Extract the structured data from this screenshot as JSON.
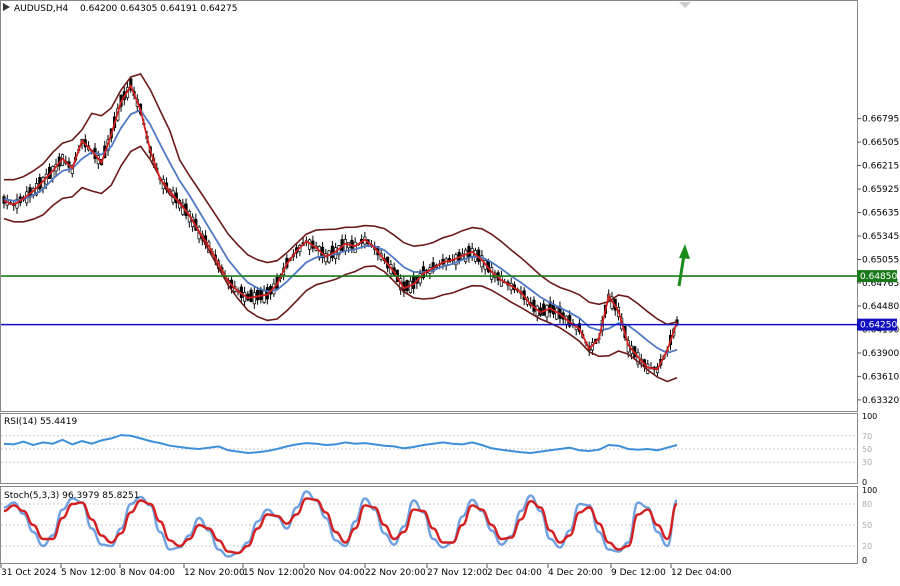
{
  "header": {
    "symbol": "AUDUSD,H4",
    "ohlc": "0.64200 0.64305 0.64191 0.64275"
  },
  "colors": {
    "price": "#000000",
    "bollinger": "#6b1a1a",
    "ma_fast": "#d42020",
    "ma_slow": "#4a7fd0",
    "support_line": "#1010c0",
    "resistance_line": "#1a7a1a",
    "arrow": "#1a8a1a",
    "rsi": "#3d8fd8",
    "stoch_main": "#6fa0e0",
    "stoch_signal": "#d42020"
  },
  "chart_data": [
    {
      "type": "line",
      "title": "AUDUSD,H4",
      "subtitle": "0.64200 0.64305 0.64191 0.64275",
      "ylim": [
        0.6322,
        0.681
      ],
      "y_ticks": [
        "0.66795",
        "0.66505",
        "0.66215",
        "0.65925",
        "0.65635",
        "0.65345",
        "0.65055",
        "0.64765",
        "0.64480",
        "0.64190",
        "0.63900",
        "0.63610",
        "0.63320"
      ],
      "x_ticks": [
        "31 Oct 2024",
        "5 Nov 12:00",
        "8 Nov 04:00",
        "12 Nov 20:00",
        "15 Nov 12:00",
        "20 Nov 04:00",
        "22 Nov 20:00",
        "27 Nov 12:00",
        "2 Dec 04:00",
        "4 Dec 20:00",
        "9 Dec 12:00",
        "12 Dec 04:00"
      ],
      "horizontal_lines": [
        {
          "label": "0.64850",
          "value": 0.6485,
          "color": "green"
        },
        {
          "label": "0.64250",
          "value": 0.6425,
          "color": "blue"
        }
      ],
      "annotation": "green up arrow",
      "series": [
        {
          "values": [
            0.6578,
            0.6573,
            0.6581,
            0.659,
            0.6602,
            0.6615,
            0.663,
            0.6618,
            0.6652,
            0.664,
            0.6625,
            0.666,
            0.67,
            0.672,
            0.669,
            0.664,
            0.6605,
            0.659,
            0.6575,
            0.656,
            0.654,
            0.6522,
            0.65,
            0.6478,
            0.6466,
            0.6458,
            0.646,
            0.6462,
            0.6475,
            0.65,
            0.6516,
            0.6528,
            0.652,
            0.6509,
            0.6515,
            0.6525,
            0.6522,
            0.653,
            0.652,
            0.6505,
            0.649,
            0.647,
            0.6475,
            0.6488,
            0.6495,
            0.6502,
            0.6505,
            0.651,
            0.6515,
            0.6505,
            0.649,
            0.648,
            0.6473,
            0.6465,
            0.645,
            0.644,
            0.6445,
            0.6438,
            0.6428,
            0.642,
            0.6395,
            0.6408,
            0.646,
            0.6442,
            0.64,
            0.6385,
            0.6372,
            0.637,
            0.6393,
            0.6428
          ]
        },
        {
          "values": [
            0.658,
            0.6578,
            0.658,
            0.6585,
            0.6592,
            0.6605,
            0.6615,
            0.6618,
            0.663,
            0.6638,
            0.6635,
            0.6645,
            0.6668,
            0.6685,
            0.669,
            0.6672,
            0.6648,
            0.6625,
            0.6603,
            0.6585,
            0.6565,
            0.6545,
            0.6525,
            0.6505,
            0.649,
            0.6477,
            0.647,
            0.6466,
            0.6468,
            0.6478,
            0.649,
            0.6502,
            0.6508,
            0.651,
            0.6512,
            0.6516,
            0.6518,
            0.6522,
            0.6522,
            0.6517,
            0.6507,
            0.6496,
            0.649,
            0.649,
            0.6492,
            0.6497,
            0.65,
            0.6505,
            0.6509,
            0.6508,
            0.6502,
            0.6494,
            0.6485,
            0.6477,
            0.6468,
            0.6459,
            0.6452,
            0.6446,
            0.644,
            0.6433,
            0.6422,
            0.6418,
            0.642,
            0.6427,
            0.6424,
            0.6415,
            0.6405,
            0.6396,
            0.639,
            0.6394
          ]
        }
      ]
    },
    {
      "type": "line",
      "title": "RSI(14) 55.4419",
      "ylim": [
        0,
        100
      ],
      "y_ticks": [
        "100",
        "70",
        "50",
        "30",
        "0"
      ],
      "series": [
        {
          "name": "RSI(14)",
          "values": [
            58,
            57,
            61,
            56,
            60,
            58,
            64,
            57,
            62,
            58,
            63,
            66,
            71,
            70,
            66,
            62,
            59,
            55,
            53,
            51,
            50,
            52,
            54,
            48,
            46,
            44,
            45,
            47,
            50,
            54,
            57,
            59,
            58,
            56,
            57,
            60,
            58,
            59,
            57,
            55,
            54,
            51,
            53,
            56,
            58,
            60,
            58,
            57,
            60,
            56,
            51,
            49,
            47,
            45,
            44,
            46,
            48,
            50,
            52,
            48,
            47,
            49,
            56,
            55,
            50,
            49,
            50,
            48,
            52,
            56
          ]
        }
      ]
    },
    {
      "type": "line",
      "title": "Stoch(5,3,3) 96.3979 85.8251",
      "ylim": [
        0,
        100
      ],
      "y_ticks": [
        "100",
        "80",
        "50",
        "20",
        "0"
      ],
      "series": [
        {
          "name": "Stoch(5,3,3)",
          "values": [
            75,
            82,
            66,
            40,
            20,
            35,
            72,
            88,
            82,
            45,
            22,
            20,
            45,
            80,
            90,
            78,
            40,
            15,
            18,
            35,
            60,
            42,
            15,
            5,
            10,
            25,
            55,
            72,
            62,
            45,
            75,
            98,
            85,
            60,
            28,
            20,
            55,
            88,
            72,
            38,
            22,
            48,
            85,
            68,
            30,
            18,
            25,
            62,
            86,
            70,
            42,
            22,
            34,
            70,
            92,
            70,
            30,
            18,
            42,
            80,
            78,
            40,
            15,
            12,
            25,
            82,
            75,
            40,
            20,
            85
          ]
        },
        {
          "name": "Stoch(5,3,3)",
          "values": [
            70,
            78,
            70,
            50,
            30,
            30,
            60,
            80,
            82,
            58,
            35,
            25,
            38,
            68,
            85,
            80,
            55,
            28,
            20,
            30,
            50,
            45,
            28,
            12,
            10,
            20,
            45,
            65,
            63,
            52,
            65,
            88,
            86,
            68,
            40,
            25,
            45,
            78,
            75,
            50,
            30,
            40,
            72,
            70,
            45,
            25,
            25,
            50,
            78,
            72,
            50,
            30,
            32,
            58,
            84,
            75,
            42,
            25,
            35,
            68,
            75,
            52,
            25,
            15,
            20,
            65,
            72,
            50,
            30,
            80
          ]
        }
      ]
    }
  ]
}
